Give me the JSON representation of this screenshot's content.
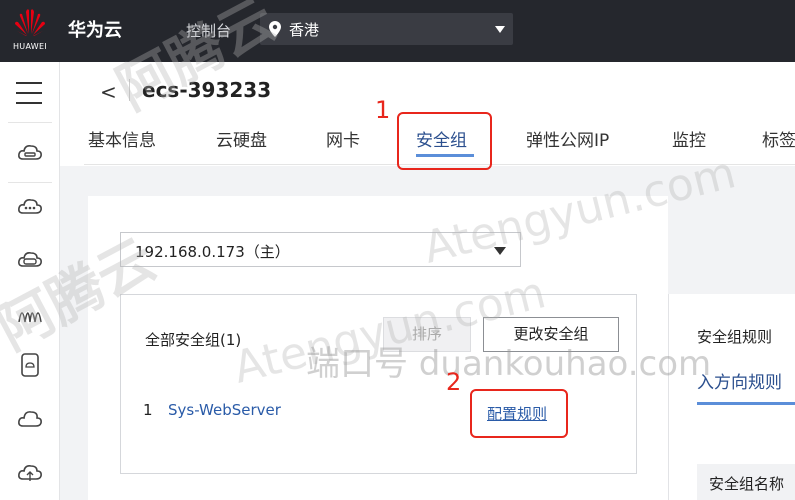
{
  "topbar": {
    "logo_text": "HUAWEI",
    "brand": "华为云",
    "console": "控制台",
    "region": "香港"
  },
  "sidebar": {
    "icons": [
      "menu-icon",
      "cloud-server-icon",
      "cloud-dots-icon",
      "cloud-disk-icon",
      "network-icon",
      "device-icon",
      "cloud-outline-icon",
      "cloud-upload-icon"
    ]
  },
  "header": {
    "back_glyph": "<",
    "title": "ecs-393233",
    "tabs": [
      "基本信息",
      "云硬盘",
      "网卡",
      "安全组",
      "弹性公网IP",
      "监控",
      "标签"
    ],
    "active_tab": "安全组"
  },
  "main": {
    "ip_select": "192.168.0.173（主）",
    "all_groups_label": "全部安全组(1)",
    "sort_button": "排序",
    "change_button": "更改安全组",
    "row": {
      "index": "1",
      "name": "Sys-WebServer",
      "action": "配置规则"
    }
  },
  "right_panel": {
    "title": "安全组规则",
    "tab": "入方向规则",
    "column": "安全组名称"
  },
  "annotations": {
    "step1": "1",
    "step2": "2",
    "color": "#e8261c"
  },
  "watermarks": [
    "阿腾云",
    "Atengyun.com",
    "端口号 duankouhao.com"
  ]
}
